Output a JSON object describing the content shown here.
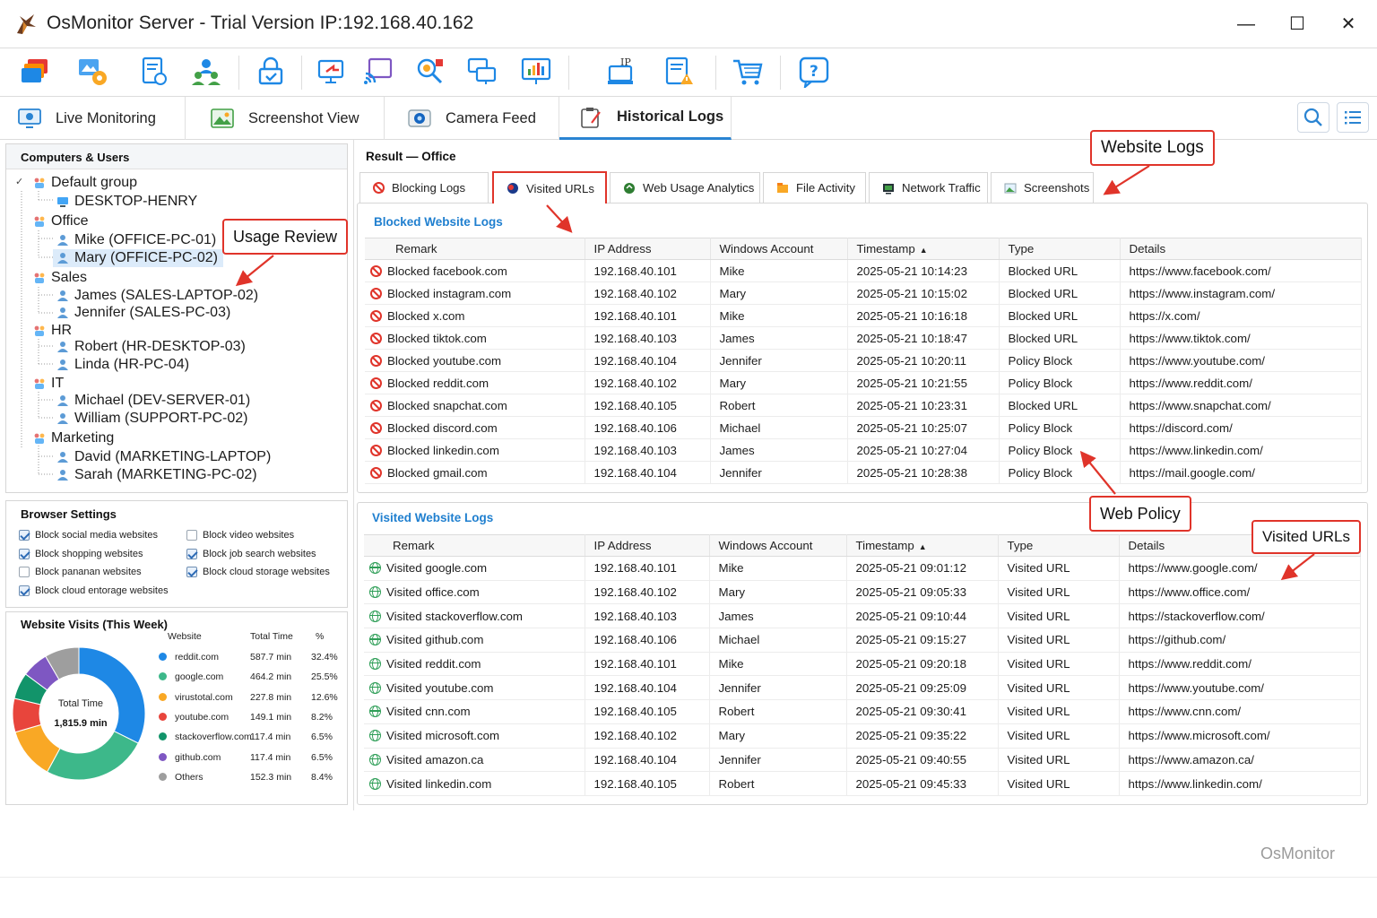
{
  "window": {
    "title": "OsMonitor Server - Trial Version IP:192.168.40.162",
    "minimize": "—",
    "maximize": "☐",
    "close": "✕"
  },
  "toolbar_icons": [
    "monitors-icon",
    "settings-icon",
    "policy-icon",
    "users-icon",
    "lock-icon",
    "remote-icon",
    "broadcast-icon",
    "search-screen-icon",
    "multi-screen-icon",
    "report-icon",
    "ip-monitor-icon",
    "alert-log-icon",
    "cart-icon",
    "help-icon"
  ],
  "nav_tabs": [
    {
      "label": "Live Monitoring",
      "icon": "monitor-icon"
    },
    {
      "label": "Screenshot View",
      "icon": "image-icon"
    },
    {
      "label": "Camera Feed",
      "icon": "camera-icon"
    },
    {
      "label": "Historical Logs",
      "icon": "clipboard-icon",
      "active": true
    }
  ],
  "tree": {
    "title": "Computers & Users",
    "groups": [
      {
        "name": "Default group",
        "members": [
          {
            "label": "DESKTOP-HENRY",
            "kind": "computer"
          }
        ]
      },
      {
        "name": "Office",
        "members": [
          {
            "label": "Mike  (OFFICE-PC-01)"
          },
          {
            "label": "Mary  (OFFICE-PC-02)",
            "selected": true
          }
        ]
      },
      {
        "name": "Sales",
        "members": [
          {
            "label": "James  (SALES-LAPTOP-02)"
          },
          {
            "label": "Jennifer  (SALES-PC-03)"
          }
        ]
      },
      {
        "name": "HR",
        "members": [
          {
            "label": "Robert  (HR-DESKTOP-03)"
          },
          {
            "label": "Linda  (HR-PC-04)"
          }
        ]
      },
      {
        "name": "IT",
        "members": [
          {
            "label": "Michael  (DEV-SERVER-01)"
          },
          {
            "label": "William  (SUPPORT-PC-02)"
          }
        ]
      },
      {
        "name": "Marketing",
        "members": [
          {
            "label": "David  (MARKETING-LAPTOP)"
          },
          {
            "label": "Sarah  (MARKETING-PC-02)"
          }
        ]
      }
    ]
  },
  "browser_settings": {
    "title": "Browser Settings",
    "options": [
      {
        "label": "Block social media websites",
        "checked": true
      },
      {
        "label": "Block video websites",
        "checked": false
      },
      {
        "label": "Block shopping websites",
        "checked": true
      },
      {
        "label": "Block job search websites",
        "checked": true
      },
      {
        "label": "Block pananan websites",
        "checked": false
      },
      {
        "label": "Block cloud storage websites",
        "checked": true
      },
      {
        "label": "Block cloud entorage websites",
        "checked": true
      }
    ]
  },
  "visits": {
    "title": "Website Visits (This Week)",
    "center_label": "Total Time",
    "center_value": "1,815.9 min",
    "headers": {
      "website": "Website",
      "time": "Total Time",
      "pct": "%"
    }
  },
  "chart_data": {
    "type": "pie",
    "title": "Website Visits (This Week)",
    "categories": [
      "reddit.com",
      "google.com",
      "virustotal.com",
      "youtube.com",
      "stackoverflow.com",
      "github.com",
      "Others"
    ],
    "values": [
      587.7,
      464.2,
      227.8,
      149.1,
      117.4,
      117.4,
      152.3
    ],
    "time_labels": [
      "587.7 min",
      "464.2 min",
      "227.8 min",
      "149.1 min",
      "117.4 min",
      "117.4 min",
      "152.3 min"
    ],
    "percent_labels": [
      "32.4%",
      "25.5%",
      "12.6%",
      "8.2%",
      "6.5%",
      "6.5%",
      "8.4%"
    ],
    "colors": [
      "#1e88e5",
      "#3db88a",
      "#f9a825",
      "#e8453c",
      "#12946a",
      "#7e57c2",
      "#9e9e9e"
    ],
    "total_label": "1,815.9 min"
  },
  "result_title": "Result — Office",
  "sub_tabs": [
    {
      "label": "Blocking Logs",
      "icon": "block-icon"
    },
    {
      "label": "Visited URLs",
      "icon": "visited-icon",
      "active": true
    },
    {
      "label": "Web Usage Analytics",
      "icon": "analytics-icon"
    },
    {
      "label": "File Activity",
      "icon": "file-icon"
    },
    {
      "label": "Network Traffic",
      "icon": "network-icon"
    },
    {
      "label": "Screenshots",
      "icon": "screenshot-icon"
    }
  ],
  "blocked": {
    "title": "Blocked Website Logs",
    "columns": [
      "Remark",
      "IP Address",
      "Windows Account",
      "Timestamp",
      "Type",
      "Details"
    ],
    "rows": [
      [
        "Blocked facebook.com",
        "192.168.40.101",
        "Mike",
        "2025-05-21 10:14:23",
        "Blocked URL",
        "https://www.facebook.com/"
      ],
      [
        "Blocked instagram.com",
        "192.168.40.102",
        "Mary",
        "2025-05-21 10:15:02",
        "Blocked URL",
        "https://www.instagram.com/"
      ],
      [
        "Blocked x.com",
        "192.168.40.101",
        "Mike",
        "2025-05-21 10:16:18",
        "Blocked URL",
        "https://x.com/"
      ],
      [
        "Blocked tiktok.com",
        "192.168.40.103",
        "James",
        "2025-05-21 10:18:47",
        "Blocked URL",
        "https://www.tiktok.com/"
      ],
      [
        "Blocked youtube.com",
        "192.168.40.104",
        "Jennifer",
        "2025-05-21 10:20:11",
        "Policy Block",
        "https://www.youtube.com/"
      ],
      [
        "Blocked reddit.com",
        "192.168.40.102",
        "Mary",
        "2025-05-21 10:21:55",
        "Policy Block",
        "https://www.reddit.com/"
      ],
      [
        "Blocked snapchat.com",
        "192.168.40.105",
        "Robert",
        "2025-05-21 10:23:31",
        "Blocked URL",
        "https://www.snapchat.com/"
      ],
      [
        "Blocked discord.com",
        "192.168.40.106",
        "Michael",
        "2025-05-21 10:25:07",
        "Policy Block",
        "https://discord.com/"
      ],
      [
        "Blocked linkedin.com",
        "192.168.40.103",
        "James",
        "2025-05-21 10:27:04",
        "Policy Block",
        "https://www.linkedin.com/"
      ],
      [
        "Blocked gmail.com",
        "192.168.40.104",
        "Jennifer",
        "2025-05-21 10:28:38",
        "Policy Block",
        "https://mail.google.com/"
      ]
    ]
  },
  "visited": {
    "title": "Visited Website Logs",
    "columns": [
      "Remark",
      "IP Address",
      "Windows Account",
      "Timestamp",
      "Type",
      "Details"
    ],
    "rows": [
      [
        "Visited google.com",
        "192.168.40.101",
        "Mike",
        "2025-05-21 09:01:12",
        "Visited URL",
        "https://www.google.com/"
      ],
      [
        "Visited office.com",
        "192.168.40.102",
        "Mary",
        "2025-05-21 09:05:33",
        "Visited URL",
        "https://www.office.com/"
      ],
      [
        "Visited stackoverflow.com",
        "192.168.40.103",
        "James",
        "2025-05-21 09:10:44",
        "Visited URL",
        "https://stackoverflow.com/"
      ],
      [
        "Visited github.com",
        "192.168.40.106",
        "Michael",
        "2025-05-21 09:15:27",
        "Visited URL",
        "https://github.com/"
      ],
      [
        "Visited reddit.com",
        "192.168.40.101",
        "Mike",
        "2025-05-21 09:20:18",
        "Visited URL",
        "https://www.reddit.com/"
      ],
      [
        "Visited youtube.com",
        "192.168.40.104",
        "Jennifer",
        "2025-05-21 09:25:09",
        "Visited URL",
        "https://www.youtube.com/"
      ],
      [
        "Visited cnn.com",
        "192.168.40.105",
        "Robert",
        "2025-05-21 09:30:41",
        "Visited URL",
        "https://www.cnn.com/"
      ],
      [
        "Visited microsoft.com",
        "192.168.40.102",
        "Mary",
        "2025-05-21 09:35:22",
        "Visited URL",
        "https://www.microsoft.com/"
      ],
      [
        "Visited amazon.ca",
        "192.168.40.104",
        "Jennifer",
        "2025-05-21 09:40:55",
        "Visited URL",
        "https://www.amazon.ca/"
      ],
      [
        "Visited linkedin.com",
        "192.168.40.105",
        "Robert",
        "2025-05-21 09:45:33",
        "Visited URL",
        "https://www.linkedin.com/"
      ]
    ]
  },
  "callouts": {
    "usage_review": "Usage Review",
    "website_logs": "Website Logs",
    "web_policy": "Web Policy",
    "visited_urls": "Visited URLs"
  },
  "watermark": "OsMonitor",
  "colors": {
    "accent": "#2a84d2",
    "callout": "#e0342a",
    "block": "#e0342a",
    "visited": "#2e9e57"
  }
}
